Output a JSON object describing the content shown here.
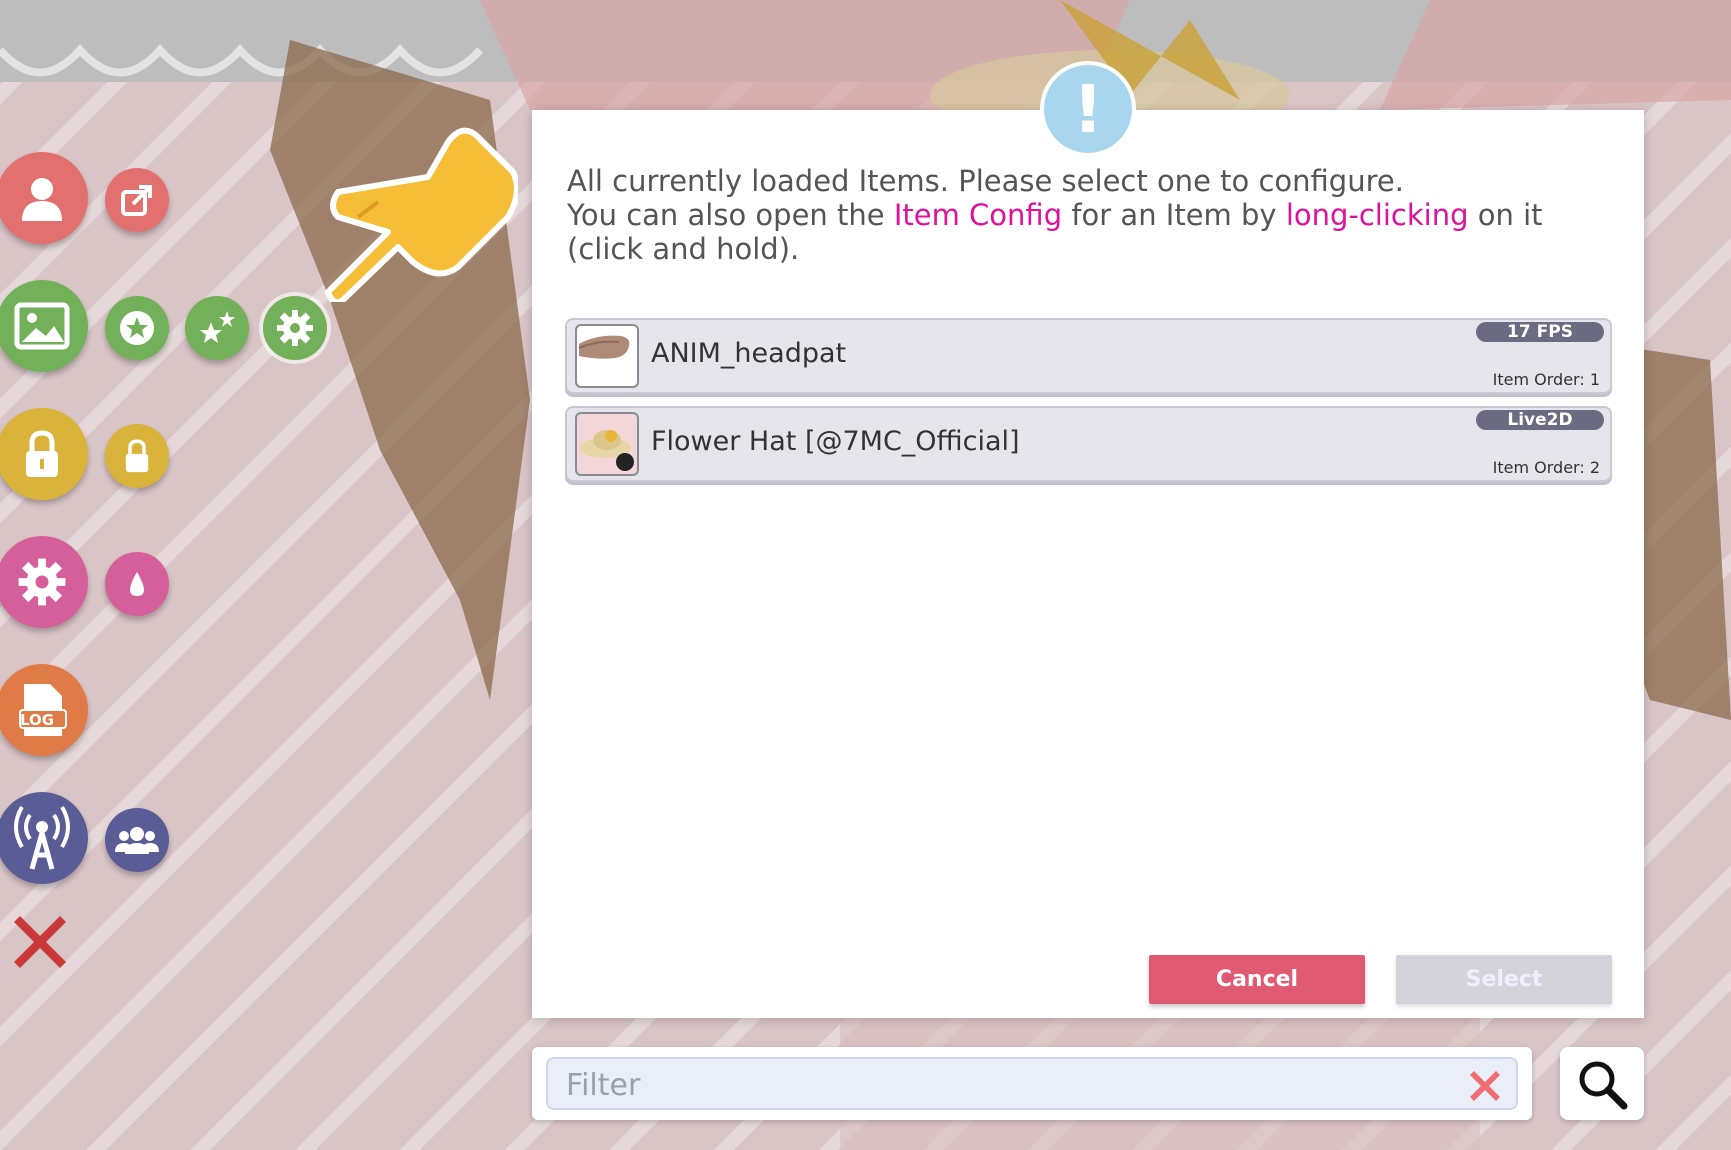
{
  "dialog": {
    "message_line1": "All currently loaded Items. Please select one to configure.",
    "message_line2_pre": "You can also open the ",
    "message_link1": "Item Config",
    "message_line2_mid": " for an Item by ",
    "message_link2": "long-clicking",
    "message_line2_post": " on it (click and hold).",
    "alert_glyph": "!",
    "items": [
      {
        "name": "ANIM_headpat",
        "badge": "17 FPS",
        "order": "Item Order: 1",
        "thumb_icon": "hand-thumbnail"
      },
      {
        "name": "Flower Hat [@7MC_Official]",
        "badge": "Live2D",
        "order": "Item Order: 2",
        "thumb_icon": "flower-hat-thumbnail"
      }
    ],
    "cancel_label": "Cancel",
    "select_label": "Select"
  },
  "filter": {
    "placeholder": "Filter",
    "value": ""
  },
  "sidebar": {
    "buttons": [
      {
        "icon": "user-icon",
        "color": "#e2706e"
      },
      {
        "icon": "export-icon",
        "color": "#e2706e"
      },
      {
        "icon": "image-icon",
        "color": "#72b05a"
      },
      {
        "icon": "star-icon",
        "color": "#72b05a"
      },
      {
        "icon": "sparkle-stars-icon",
        "color": "#72b05a"
      },
      {
        "icon": "gear-icon",
        "color": "#72b05a"
      },
      {
        "icon": "lock-icon",
        "color": "#d9b33a"
      },
      {
        "icon": "lock-small-icon",
        "color": "#d9b33a"
      },
      {
        "icon": "settings-gear-icon",
        "color": "#d55f9a"
      },
      {
        "icon": "drop-icon",
        "color": "#d55f9a"
      },
      {
        "icon": "log-file-icon",
        "color": "#e07a47"
      },
      {
        "icon": "broadcast-tower-icon",
        "color": "#5a5c96"
      },
      {
        "icon": "group-icon",
        "color": "#5a5c96"
      },
      {
        "icon": "close-x-icon",
        "color": "#c9393a"
      }
    ],
    "log_label": "LOG"
  },
  "colors": {
    "accent_link": "#e0119a",
    "cancel": "#e05a74",
    "select_disabled": "#d4d3dc",
    "alert": "#a9d6ef"
  }
}
